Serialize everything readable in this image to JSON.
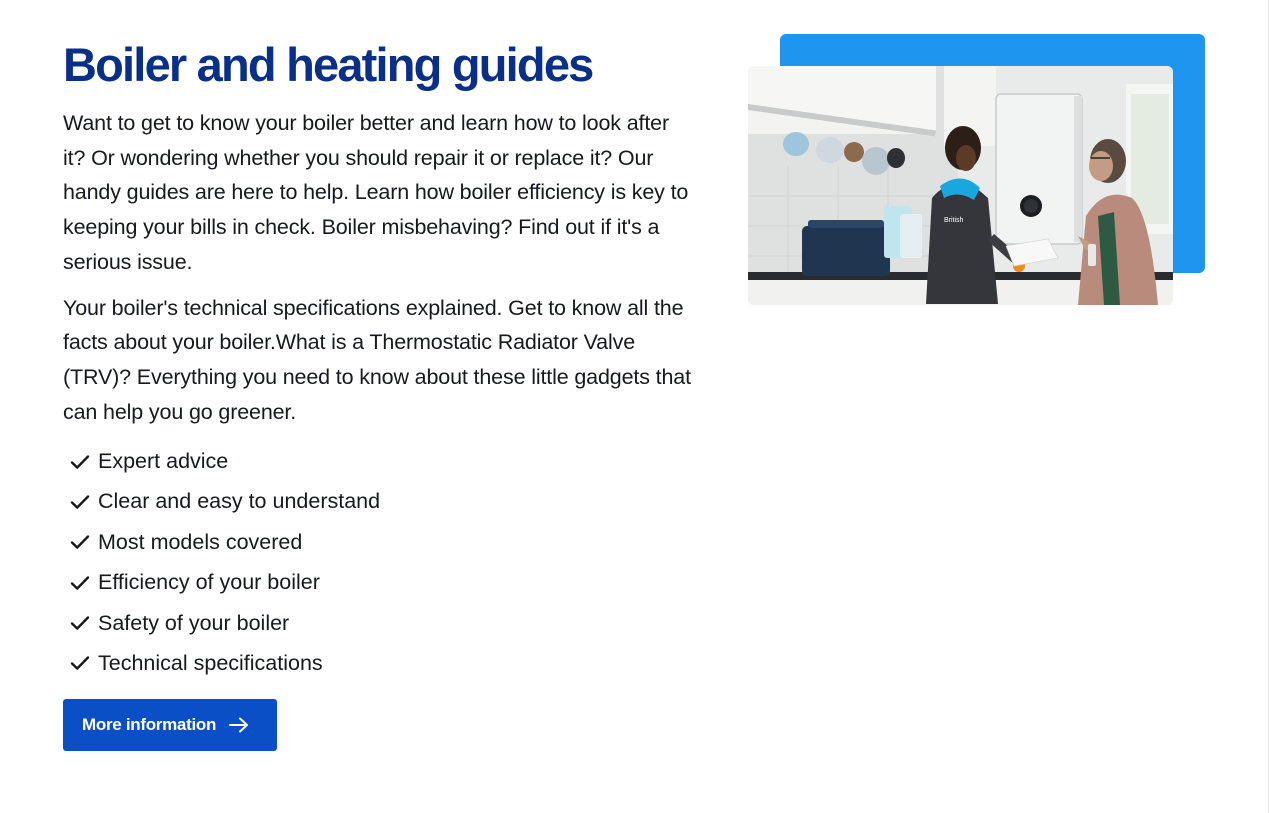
{
  "heading": "Boiler and heating guides",
  "paragraphs": [
    "Want to get to know your boiler better and learn how to look after it? Or wondering whether you should repair it or replace it? Our handy guides are here to help. Learn how boiler efficiency is key to keeping your bills in check. Boiler misbehaving? Find out if it's a serious issue.",
    "Your boiler's technical specifications explained. Get to know all the facts about your boiler.What is a Thermostatic Radiator Valve (TRV)? Everything you need to know about these little gadgets that can help you go greener."
  ],
  "features": [
    "Expert advice",
    "Clear and easy to understand",
    "Most models covered",
    "Efficiency of your boiler",
    "Safety of your boiler",
    "Technical specifications"
  ],
  "cta": {
    "label": "More information",
    "icon": "arrow-right-icon"
  },
  "image": {
    "icon": "engineer-boiler-photo",
    "tunic_label": "British"
  },
  "colors": {
    "heading": "#0a2f87",
    "button": "#0b4fc7",
    "accent_panel": "#1e96f0"
  }
}
